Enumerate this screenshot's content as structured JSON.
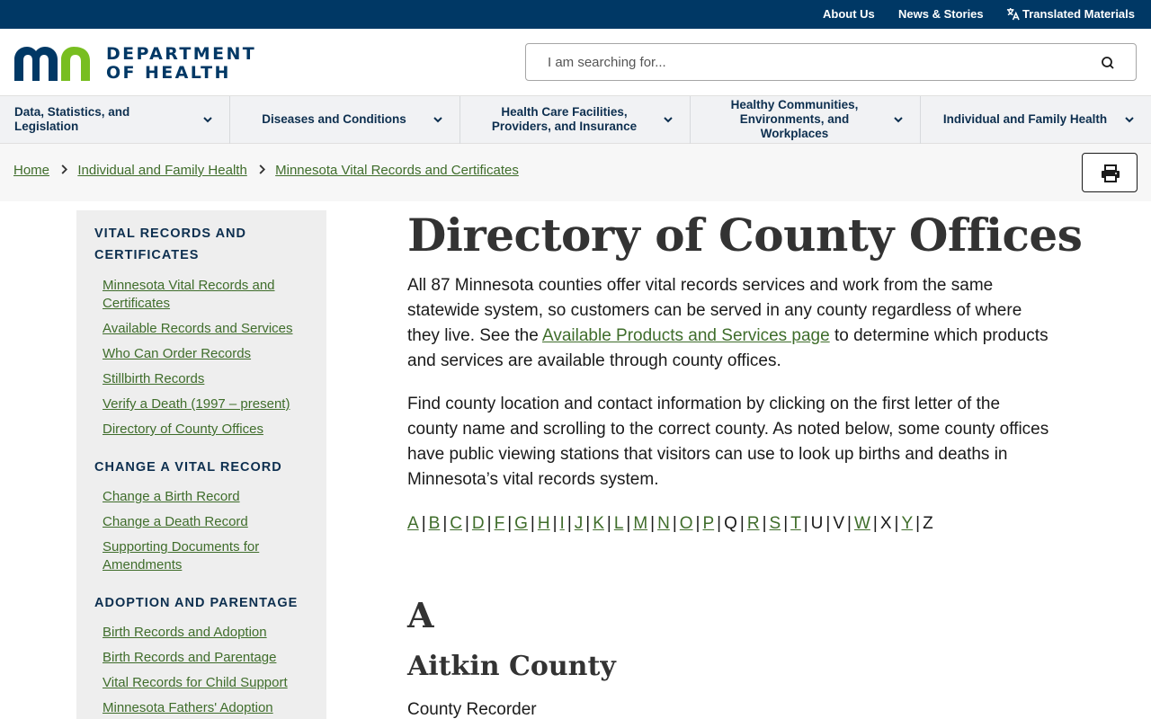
{
  "utility": {
    "about": "About Us",
    "news": "News & Stories",
    "translated": "Translated Materials"
  },
  "logo": {
    "line1": "DEPARTMENT",
    "line2": "OF HEALTH",
    "brand_blue": "#003865",
    "brand_green": "#78be20"
  },
  "search": {
    "placeholder": "I am searching for..."
  },
  "nav": [
    {
      "label": "Data, Statistics, and Legislation"
    },
    {
      "label": "Diseases and Conditions"
    },
    {
      "label": "Health Care Facilities, Providers, and Insurance"
    },
    {
      "label": "Healthy Communities, Environments, and Workplaces"
    },
    {
      "label": "Individual and Family Health"
    }
  ],
  "breadcrumb": [
    {
      "label": "Home"
    },
    {
      "label": "Individual and Family Health"
    },
    {
      "label": "Minnesota Vital Records and Certificates"
    }
  ],
  "sidebar": {
    "sections": [
      {
        "heading": "Vital Records and Certificates",
        "links": [
          "Minnesota Vital Records and Certificates",
          "Available Records and Services",
          "Who Can Order Records",
          "Stillbirth Records",
          "Verify a Death (1997 – present)",
          "Directory of County Offices"
        ]
      },
      {
        "heading": "Change a Vital Record",
        "links": [
          "Change a Birth Record",
          "Change a Death Record",
          "Supporting Documents for Amendments"
        ]
      },
      {
        "heading": "Adoption and Parentage",
        "links": [
          "Birth Records and Adoption",
          "Birth Records and Parentage",
          "Vital Records for Child Support",
          "Minnesota Fathers' Adoption"
        ]
      }
    ]
  },
  "content": {
    "title": "Directory of County Offices",
    "para1_before": "All 87 Minnesota counties offer vital records services and work from the same statewide system, so customers can be served in any county regardless of where they live. See the ",
    "para1_link": "Available Products and Services page",
    "para1_after": " to determine which products and services are available through county offices.",
    "para2": "Find county location and contact information by clicking on the first letter of the county name and scrolling to the correct county. As noted below, some county offices have public viewing stations that visitors can use to look up births and deaths in Minnesota’s vital records system.",
    "alphabet": [
      {
        "letter": "A",
        "link": true
      },
      {
        "letter": "B",
        "link": true
      },
      {
        "letter": "C",
        "link": true
      },
      {
        "letter": "D",
        "link": true
      },
      {
        "letter": "F",
        "link": true
      },
      {
        "letter": "G",
        "link": true
      },
      {
        "letter": "H",
        "link": true
      },
      {
        "letter": "I",
        "link": true
      },
      {
        "letter": "J",
        "link": true
      },
      {
        "letter": "K",
        "link": true
      },
      {
        "letter": "L",
        "link": true
      },
      {
        "letter": "M",
        "link": true
      },
      {
        "letter": "N",
        "link": true
      },
      {
        "letter": "O",
        "link": true
      },
      {
        "letter": "P",
        "link": true
      },
      {
        "letter": "Q",
        "link": false
      },
      {
        "letter": "R",
        "link": true
      },
      {
        "letter": "S",
        "link": true
      },
      {
        "letter": "T",
        "link": true
      },
      {
        "letter": "U",
        "link": false
      },
      {
        "letter": "V",
        "link": false
      },
      {
        "letter": "W",
        "link": true
      },
      {
        "letter": "X",
        "link": false
      },
      {
        "letter": "Y",
        "link": true
      },
      {
        "letter": "Z",
        "link": false
      }
    ],
    "section_letter": "A",
    "county_name": "Aitkin County",
    "county_sub": "County Recorder"
  },
  "colors": {
    "utility_bg": "#003865",
    "link_green": "#3f6d2b",
    "nav_bg": "#f1f2f4",
    "sidebar_bg": "#eeeeee"
  }
}
